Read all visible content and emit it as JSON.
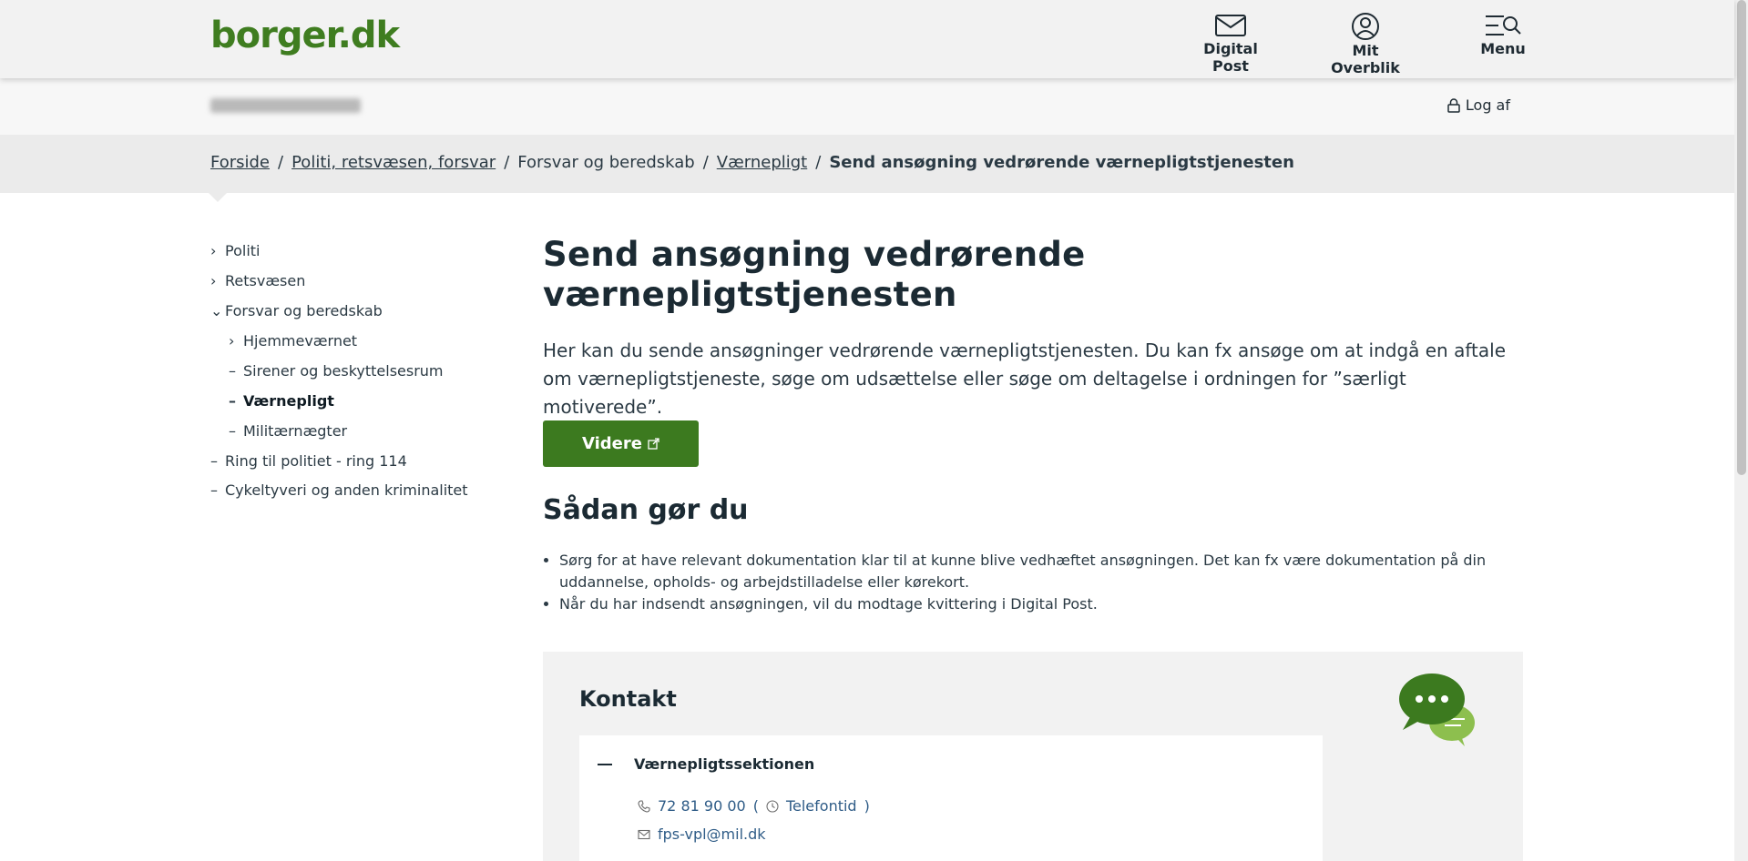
{
  "header": {
    "logo": "borger.dk",
    "digital_post": "Digital Post",
    "mit_overblik": "Mit Overblik",
    "menu": "Menu"
  },
  "userbar": {
    "logout": "Log af"
  },
  "breadcrumb": {
    "items": [
      "Forside",
      "Politi, retsvæsen, forsvar",
      "Forsvar og beredskab",
      "Værnepligt"
    ],
    "current": "Send ansøgning vedrørende værnepligtstjenesten"
  },
  "sidenav": {
    "items": [
      {
        "label": "Politi",
        "marker": "›"
      },
      {
        "label": "Retsvæsen",
        "marker": "›"
      },
      {
        "label": "Forsvar og beredskab",
        "marker": "⌄"
      },
      {
        "label": "Hjemmeværnet",
        "marker": "›"
      },
      {
        "label": "Sirener og beskyttelsesrum",
        "marker": "–"
      },
      {
        "label": "Værnepligt",
        "marker": "–"
      },
      {
        "label": "Militærnægter",
        "marker": "–"
      },
      {
        "label": "Ring til politiet - ring 114",
        "marker": "–"
      },
      {
        "label": "Cykeltyveri og anden kriminalitet",
        "marker": "–"
      }
    ]
  },
  "main": {
    "title_line1": "Send ansøgning vedrørende",
    "title_line2": "værnepligtstjenesten",
    "lead": "Her kan du sende ansøgninger vedrørende værnepligtstjenesten. Du kan fx ansøge om at indgå en aftale om værnepligtstjeneste, søge om udsættelse eller søge om deltagelse i ordningen for ”særligt motiverede”.",
    "button": "Videre",
    "howto_title": "Sådan gør du",
    "steps": [
      "Sørg for at have relevant dokumentation klar til at kunne blive vedhæftet ansøgningen. Det kan fx være dokumentation på din uddannelse, opholds- og arbejdstilladelse eller kørekort.",
      "Når du har indsendt ansøgningen, vil du modtage kvittering i Digital Post."
    ]
  },
  "contact": {
    "title": "Kontakt",
    "name": "Værnepligtssektionen",
    "phone": "72 81 90 00",
    "paren_open": "(",
    "phone_hours": "Telefontid",
    "paren_close": ")",
    "email": "fps-vpl@mil.dk"
  },
  "colors": {
    "brand_green": "#3f7d20",
    "button_green": "#3c7a1f",
    "header_bg": "#f2f2f2",
    "breadcrumb_bg": "#ebebeb"
  }
}
